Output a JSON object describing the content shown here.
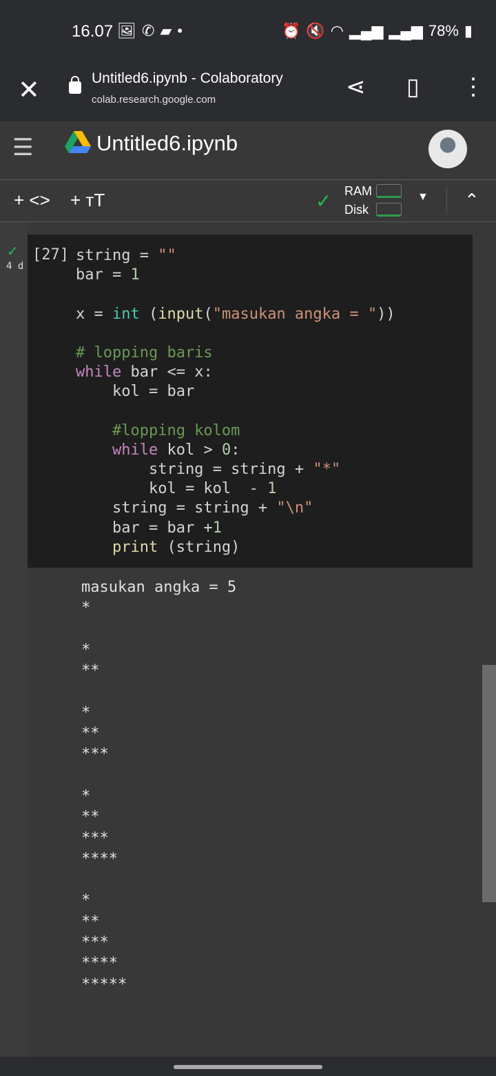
{
  "status_bar": {
    "time": "16.07",
    "battery": "78%",
    "left_icons": [
      "gallery-icon",
      "whatsapp-icon",
      "message-icon",
      "dot-icon"
    ],
    "right_icons": [
      "alarm-icon",
      "mute-icon",
      "wifi-icon",
      "signal-icon",
      "signal-icon",
      "battery-icon"
    ]
  },
  "browser": {
    "title": "Untitled6.ipynb - Colaboratory",
    "url": "colab.research.google.com"
  },
  "notebook": {
    "title": "Untitled6.ipynb"
  },
  "toolbar": {
    "add_code": "+ <>",
    "add_text": "+ ᴛT",
    "ram_label": "RAM",
    "disk_label": "Disk"
  },
  "cell": {
    "exec_count": "[27]",
    "age": "4 d",
    "code": [
      [
        [
          "string = ",
          ""
        ],
        [
          "\"\"",
          "str"
        ]
      ],
      [
        [
          "bar = ",
          ""
        ],
        [
          "1",
          "num"
        ]
      ],
      [],
      [
        [
          "x = ",
          ""
        ],
        [
          "int",
          "bi"
        ],
        [
          " (",
          ""
        ],
        [
          "input",
          "fn"
        ],
        [
          "(",
          ""
        ],
        [
          "\"masukan angka = \"",
          "str"
        ],
        [
          "))",
          ""
        ]
      ],
      [],
      [
        [
          "# lopping baris",
          "cm"
        ]
      ],
      [
        [
          "while",
          "kw"
        ],
        [
          " bar <= x:",
          ""
        ]
      ],
      [
        [
          "    kol = bar",
          ""
        ]
      ],
      [],
      [
        [
          "    #lopping kolom",
          "cm"
        ]
      ],
      [
        [
          "    ",
          ""
        ],
        [
          "while",
          "kw"
        ],
        [
          " kol > ",
          ""
        ],
        [
          "0",
          "num"
        ],
        [
          ":",
          ""
        ]
      ],
      [
        [
          "        string = string + ",
          ""
        ],
        [
          "\"*\"",
          "str"
        ]
      ],
      [
        [
          "        kol = kol  - ",
          ""
        ],
        [
          "1",
          "num"
        ]
      ],
      [
        [
          "    string = string + ",
          ""
        ],
        [
          "\"\\n\"",
          "str"
        ]
      ],
      [
        [
          "    bar = bar +",
          ""
        ],
        [
          "1",
          "num"
        ]
      ],
      [
        [
          "    ",
          ""
        ],
        [
          "print",
          "fn"
        ],
        [
          " (string)",
          ""
        ]
      ]
    ],
    "output": [
      "masukan angka = 5",
      "*",
      "",
      "*",
      "**",
      "",
      "*",
      "**",
      "***",
      "",
      "*",
      "**",
      "***",
      "****",
      "",
      "*",
      "**",
      "***",
      "****",
      "*****"
    ]
  }
}
